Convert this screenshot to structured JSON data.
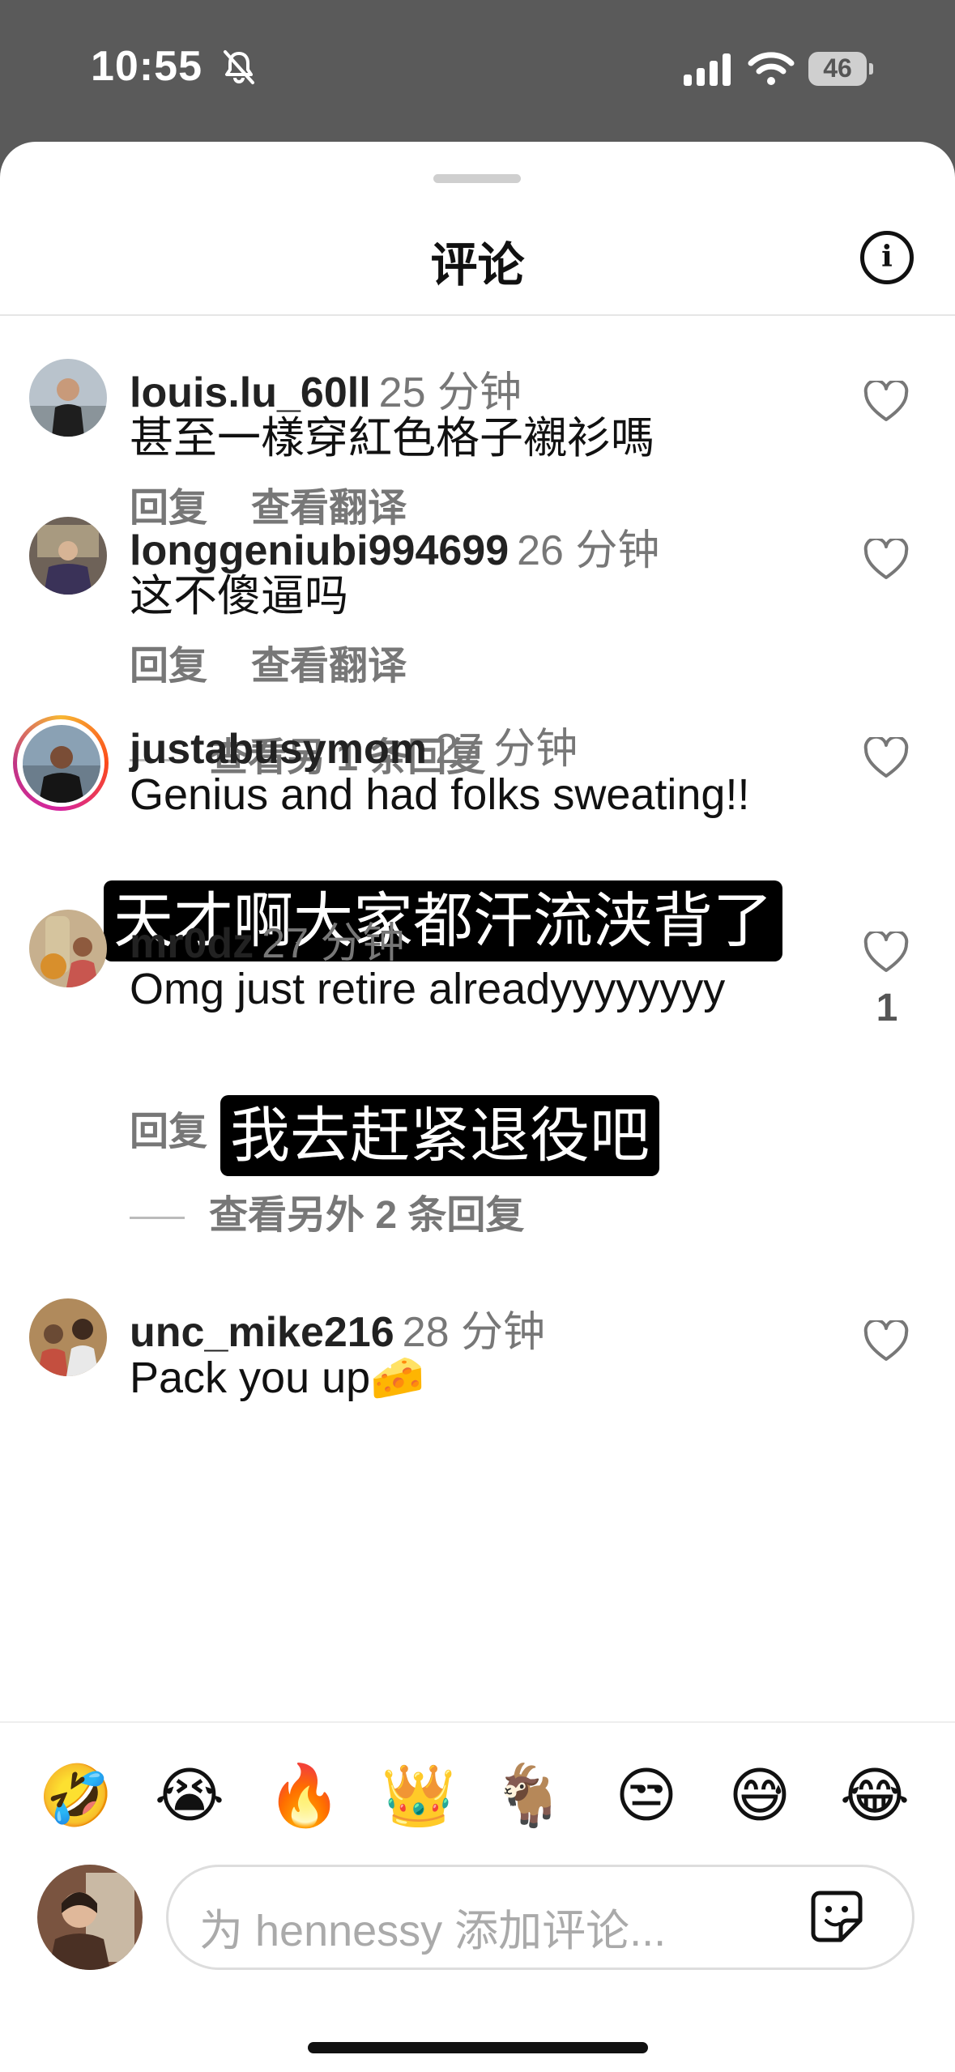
{
  "status_bar": {
    "time": "10:55",
    "battery": "46"
  },
  "sheet": {
    "title": "评论"
  },
  "comments": [
    {
      "username": "louis.lu_60ll",
      "time": "25 分钟",
      "text": "甚至一樣穿紅色格子襯衫嗎",
      "reply": "回复",
      "translate": "查看翻译"
    },
    {
      "username": "longgeniubi994699",
      "time": "26 分钟",
      "text": "这不傻逼吗",
      "reply": "回复",
      "translate": "查看翻译",
      "more_replies": "查看另 1 条回复"
    },
    {
      "username": "justabusymom",
      "time": "27 分钟",
      "text": "Genius and had folks sweating!!",
      "caption": "天才啊大家都汗流浃背了"
    },
    {
      "username": "mr0dz",
      "time": "27 分钟",
      "text": "Omg just retire alreadyyyyyyyy",
      "reply": "回复",
      "caption": "我去赶紧退役吧",
      "likes": "1",
      "more_replies": "查看另外 2 条回复"
    },
    {
      "username": "unc_mike216",
      "time": "28 分钟",
      "text": "Pack you up🧀"
    }
  ],
  "emoji_bar": [
    "🤣",
    "😭",
    "🔥",
    "👑",
    "🐐",
    "😒",
    "😅",
    "😂"
  ],
  "composer": {
    "placeholder": "为 hennessy 添加评论..."
  }
}
